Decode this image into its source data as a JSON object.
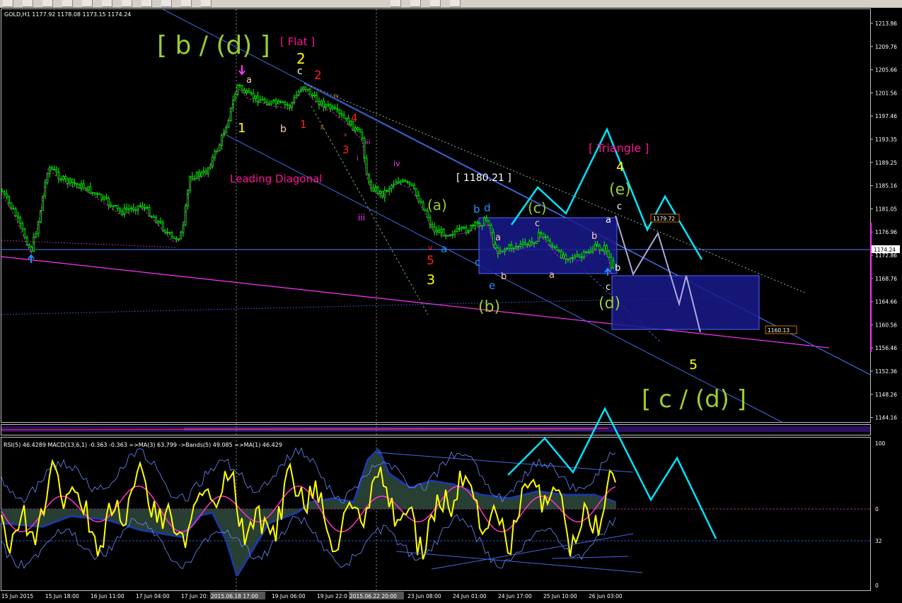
{
  "toolbar": {
    "buttons": [
      "arrow-icon",
      "cursor-icon",
      "crosshair-icon",
      "vline-icon",
      "hline-icon",
      "trendline-icon",
      "pencil-icon",
      "pen-icon",
      "period-icon",
      "new-chart-icon",
      "zoom-icon",
      "properties-icon",
      "template-icon",
      "indicator-icon",
      "fib-icon"
    ]
  },
  "chart_header": "GOLD,H1  1177.92 1178.08 1173.15 1174.24",
  "indicator_header": "RSI(5) 46.4289  MACD(13,6,1) -0.363 -0.363  =>MA(3) 63.799  ->Bands(5) 49.085  =>MA(1) 46.429",
  "price_axis": {
    "labels": [
      "1213.86",
      "1209.76",
      "1205.66",
      "1201.56",
      "1197.46",
      "1193.35",
      "1189.25",
      "1185.16",
      "1181.05",
      "1176.96",
      "1172.86",
      "1168.76",
      "1164.66",
      "1160.56",
      "1156.46",
      "1152.36",
      "1148.26",
      "1144.16"
    ],
    "current_price": "1174.24"
  },
  "indicator_axis": {
    "labels": [
      "100",
      "0",
      "32",
      "0"
    ]
  },
  "time_axis": {
    "labels": [
      "15 Jun 2015",
      "15 Jun 18:00",
      "16 Jun 11:00",
      "17 Jun 04:00",
      "17 Jun 20:",
      "2015.06.18 17:00",
      "19 Jun 06:00",
      "19 Jun 22:0",
      "2015.06.22 20:00",
      "23 Jun 08:00",
      "24 Jun 01:00",
      "24 Jun 17:00",
      "25 Jun 10:00",
      "26 Jun 03:00"
    ]
  },
  "price_tags": {
    "upper": "1179.72",
    "lower": "1160.13"
  },
  "annotations": {
    "b_d": "[ b / (d) ]",
    "flat": "[ Flat ]",
    "two_yellow": "2",
    "c_white_top": "c",
    "two_red": "2",
    "a_top": "a",
    "one_yellow": "1",
    "b_white": "b",
    "one_red": "1",
    "four_red": "4",
    "three_red": "3",
    "iv_small": "iv",
    "ii_small": "ii",
    "v_small": "v",
    "iii_small": "iii",
    "i_small": "i",
    "iii_mid": "iii",
    "iv_mid": "iv",
    "leading_diagonal": "Leading Diagonal",
    "price_1180": "[ 1180.21 ]",
    "triangle": "[ Triangle ]",
    "four_yellow": "4",
    "e_paren": "(e)",
    "c_paren": "(c)",
    "a_paren": "(a)",
    "b_paren": "(b)",
    "d_paren": "(d)",
    "v_red": "v",
    "five_red": "5",
    "three_yellow": "3",
    "a_blue": "a",
    "b_blue": "b",
    "d_blue": "d",
    "c_blue": "c",
    "e_blue": "e",
    "a_white1": "a",
    "b_white1": "b",
    "c_white1": "c",
    "a_white2": "a",
    "b_white2": "b",
    "a_white3": "a",
    "c_white2": "c",
    "b_white3": "b",
    "c_white3": "c",
    "five_yellow": "5",
    "c_d": "[ c / (d) ]"
  },
  "colors": {
    "candle": "#00ff00",
    "wave_yellow_green": "#9acd32",
    "wave_magenta": "#ff1493",
    "wave_red": "#ff2020",
    "wave_yellow": "#ffff00",
    "wave_blue": "#1e90ff",
    "projection": "#00e5ff",
    "box": "#1a1a8c",
    "trendline": "#4169e1",
    "support_line": "#ff33ff"
  }
}
